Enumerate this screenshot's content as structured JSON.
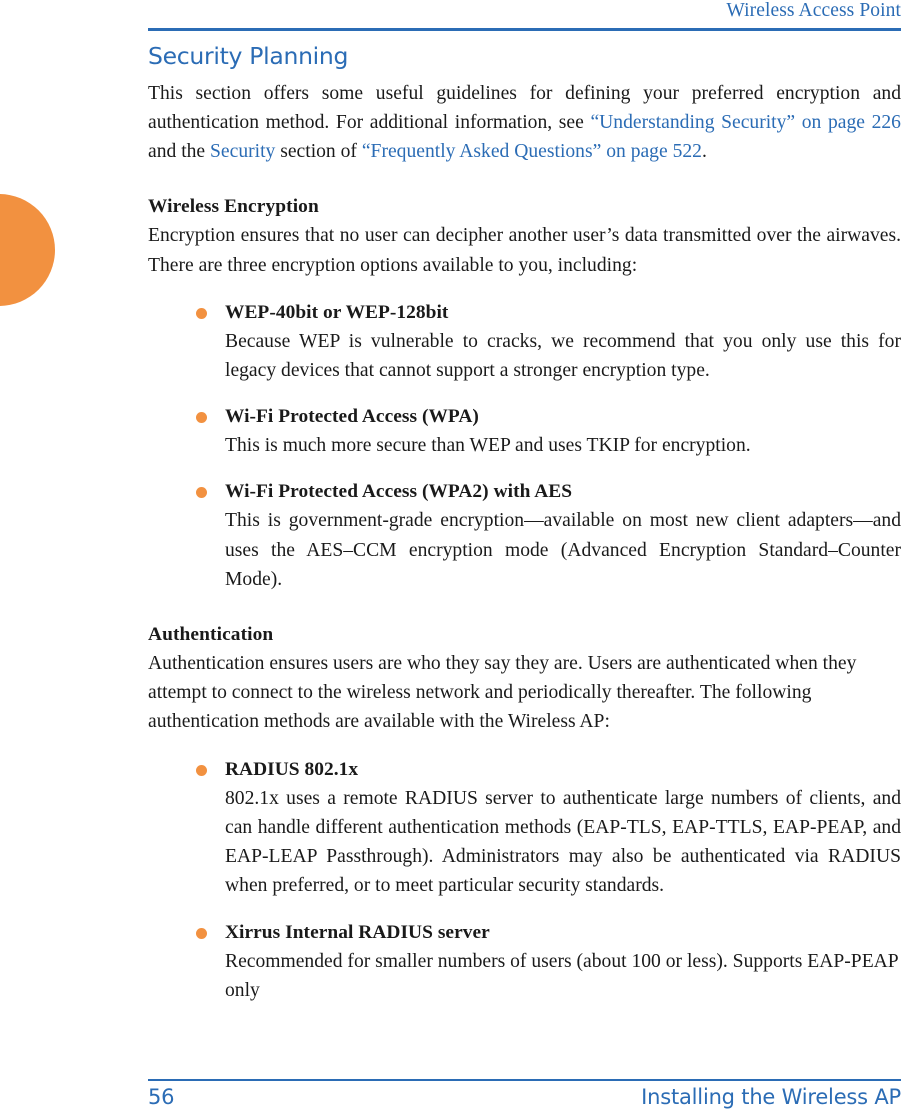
{
  "header": {
    "running_head": "Wireless Access Point"
  },
  "footer": {
    "page_number": "56",
    "section_title": "Installing the Wireless AP"
  },
  "main": {
    "chapter_title": "Security Planning",
    "intro": {
      "part1": "This section offers some useful guidelines for defining your preferred encryption and authentication method. For additional information, see ",
      "link1": "“Understanding Security” on page 226",
      "part2": " and the ",
      "link2": "Security",
      "part3": " section of ",
      "link3": "“Frequently Asked Questions” on page 522",
      "part4": "."
    },
    "sections": [
      {
        "heading": "Wireless Encryption",
        "intro": "Encryption ensures that no user can decipher another user’s data transmitted over the airwaves. There are three encryption options available to you, including:",
        "bullets": [
          {
            "title": "WEP-40bit or WEP-128bit",
            "body": "Because WEP is vulnerable to cracks, we recommend that you only use this for legacy devices that cannot support a stronger encryption type."
          },
          {
            "title": "Wi-Fi Protected Access (WPA)",
            "body": "This is much more secure than WEP and uses TKIP for encryption."
          },
          {
            "title": "Wi-Fi Protected Access (WPA2) with AES",
            "body": "This is government-grade encryption—available on most new client adapters—and uses the AES–CCM encryption mode (Advanced Encryption Standard–Counter Mode)."
          }
        ]
      },
      {
        "heading": "Authentication",
        "intro": "Authentication ensures users are who they say they are. Users are authenticated when they attempt to connect to the wireless network and periodically thereafter. The following authentication methods are available with the Wireless AP:",
        "bullets": [
          {
            "title": "RADIUS 802.1x",
            "body": "802.1x uses a remote RADIUS server to authenticate large numbers of clients, and can handle different authentication methods (EAP-TLS, EAP-TTLS, EAP-PEAP, and EAP-LEAP Passthrough). Administrators may also be authenticated via RADIUS when preferred, or to meet particular security standards."
          },
          {
            "title": "Xirrus Internal RADIUS server",
            "body": "Recommended for smaller numbers of users (about 100 or less). Supports EAP-PEAP only"
          }
        ]
      }
    ]
  },
  "colors": {
    "accent_blue": "#2b6cb5",
    "accent_orange": "#f29140",
    "body_text": "#1a1a1a"
  }
}
